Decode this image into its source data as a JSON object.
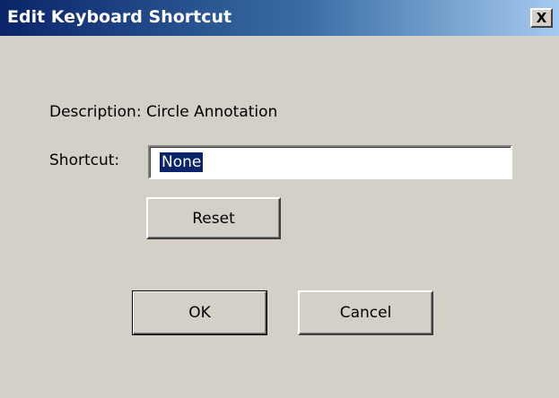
{
  "window": {
    "title": "Edit Keyboard Shortcut",
    "close_label": "X"
  },
  "form": {
    "description_text": "Description: Circle Annotation",
    "shortcut_label": "Shortcut:",
    "shortcut_value": "None"
  },
  "buttons": {
    "reset": "Reset",
    "ok": "OK",
    "cancel": "Cancel"
  },
  "colors": {
    "title_bar_start": "#0a246a",
    "title_bar_end": "#a6caf0",
    "dialog_background": "#d4d0c8",
    "selection_highlight": "#0a246a"
  }
}
